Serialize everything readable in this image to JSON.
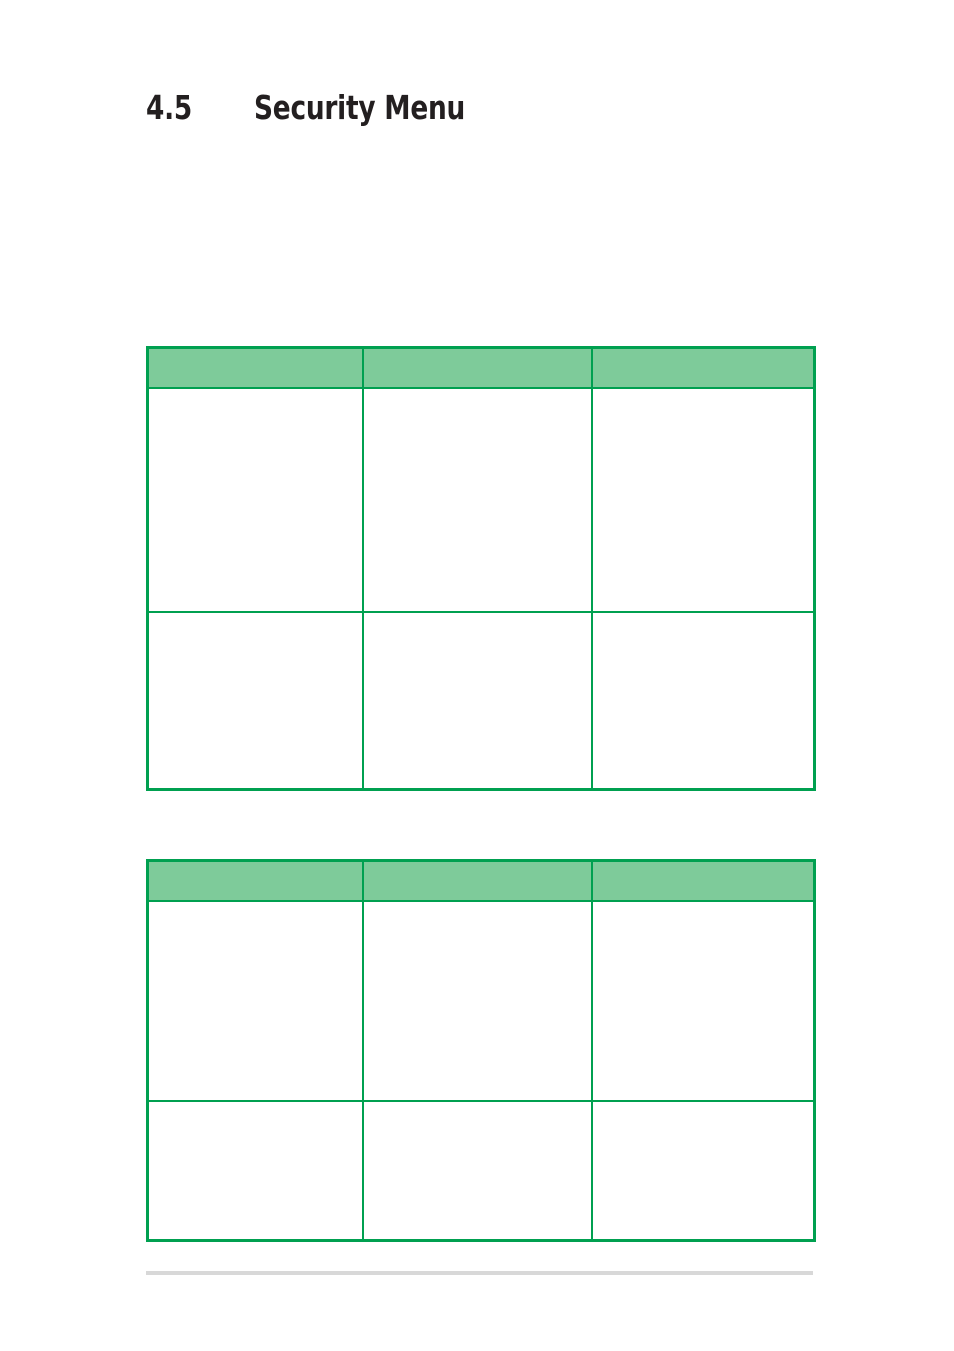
{
  "page": {
    "heading": {
      "number": "4.5",
      "title": "Security Menu"
    },
    "background_color": "#ffffff",
    "text_color": "#231f20"
  },
  "theme": {
    "table_border_color": "#00a050",
    "table_header_fill": "#7ecb9a",
    "footer_rule_color": "#d8d8d8"
  },
  "tables": [
    {
      "name": "table-one",
      "columns": [
        "",
        "",
        ""
      ],
      "header": [
        "",
        "",
        ""
      ],
      "rows": [
        [
          "",
          "",
          ""
        ],
        [
          "",
          "",
          ""
        ]
      ]
    },
    {
      "name": "table-two",
      "columns": [
        "",
        "",
        ""
      ],
      "header": [
        "",
        "",
        ""
      ],
      "rows": [
        [
          "",
          "",
          ""
        ],
        [
          "",
          "",
          ""
        ]
      ]
    }
  ],
  "footer": {
    "rule": ""
  }
}
